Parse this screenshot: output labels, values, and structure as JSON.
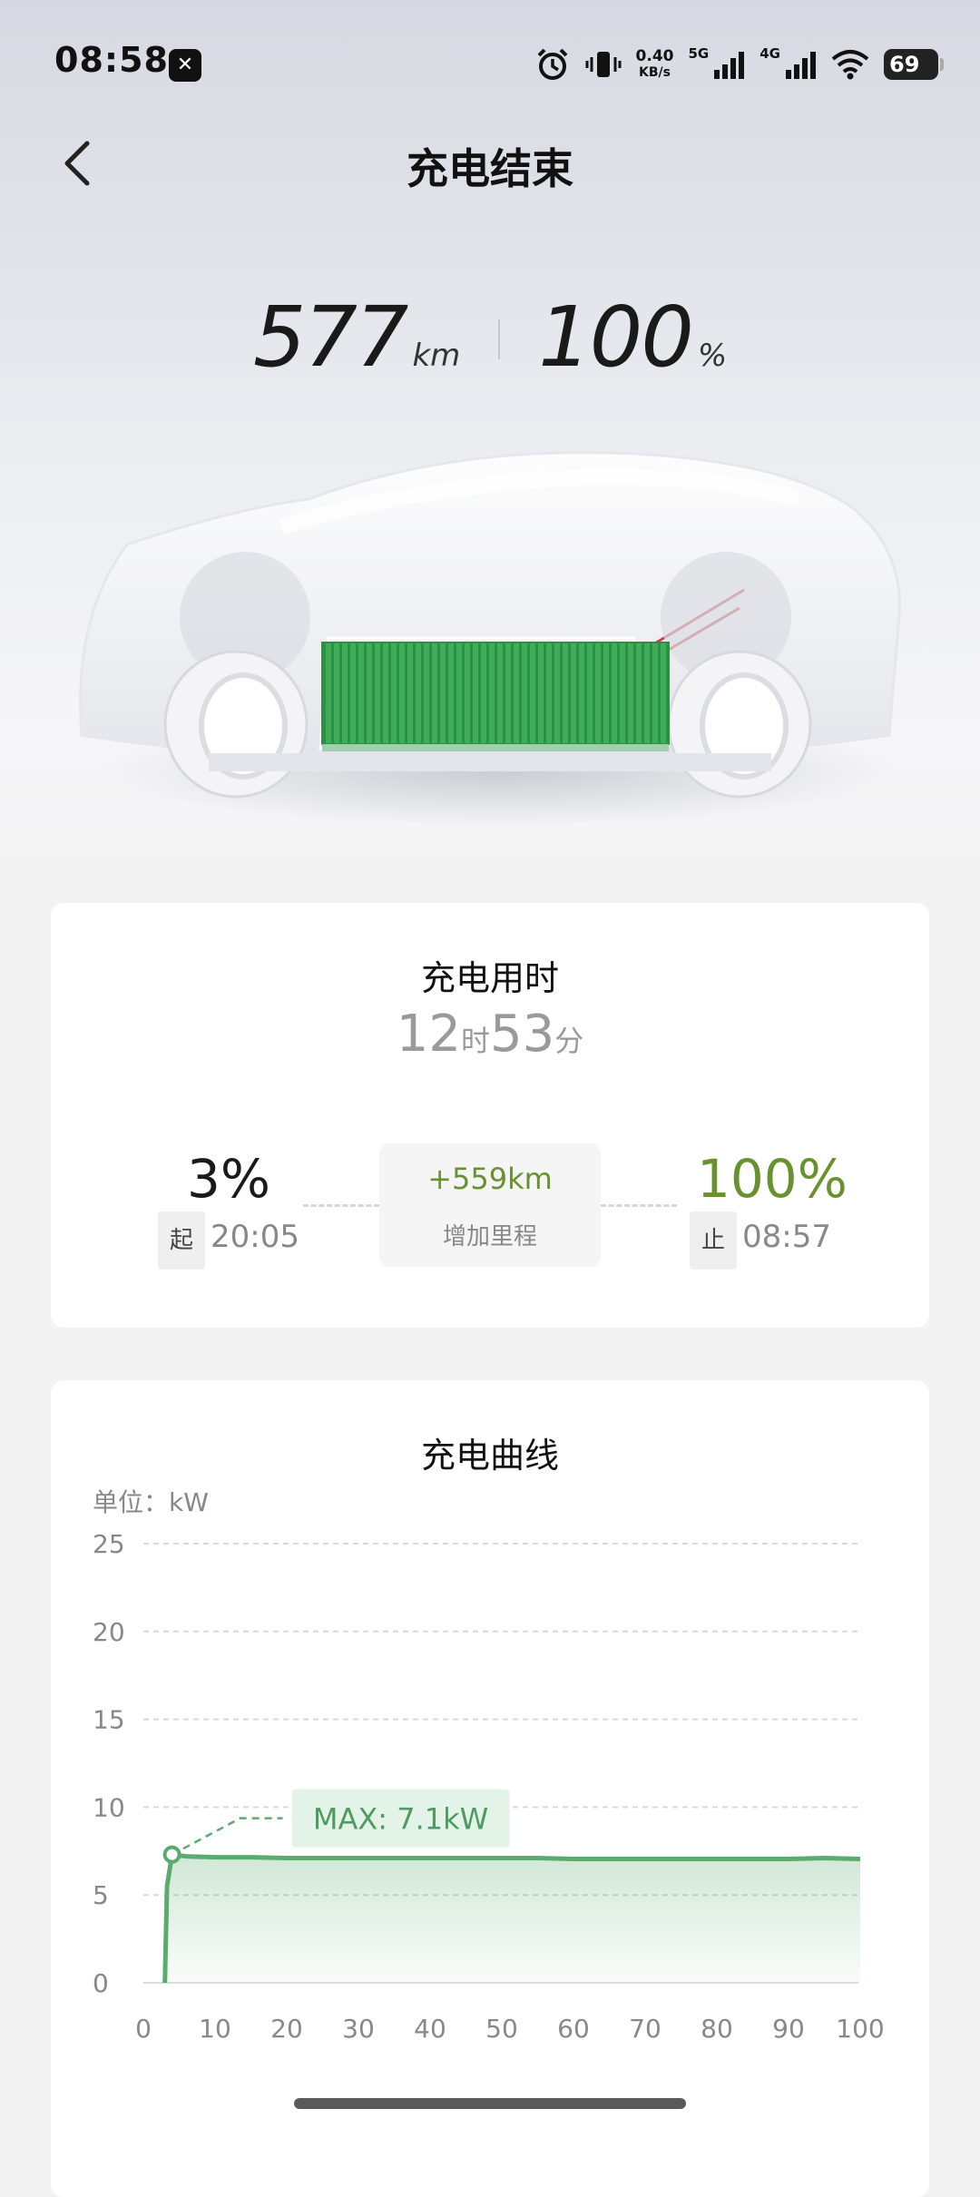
{
  "status_bar": {
    "time": "08:58",
    "net_speed_value": "0.40",
    "net_speed_unit": "KB/s",
    "sim1": "5G",
    "sim2": "4G",
    "battery": "69"
  },
  "nav": {
    "title": "充电结束"
  },
  "summary": {
    "range_value": "577",
    "range_unit": "km",
    "soc_value": "100",
    "soc_unit": "%"
  },
  "duration_card": {
    "title": "充电用时",
    "hours": "12",
    "hours_unit": "时",
    "minutes": "53",
    "minutes_unit": "分",
    "start_soc": "3%",
    "start_tag": "起",
    "start_time": "20:05",
    "added_range": "+559km",
    "added_label": "增加里程",
    "end_soc": "100%",
    "end_tag": "止",
    "end_time": "08:57"
  },
  "curve_card": {
    "title": "充电曲线"
  },
  "chart_data": {
    "type": "area",
    "title": "充电曲线",
    "unit_label": "单位：kW",
    "xlim": [
      0,
      100
    ],
    "ylim": [
      0,
      25
    ],
    "x_ticks": [
      0,
      10,
      20,
      30,
      40,
      50,
      60,
      70,
      80,
      90,
      100
    ],
    "y_ticks": [
      0,
      5,
      10,
      15,
      20,
      25
    ],
    "grid": true,
    "annotation": "MAX: 7.1kW",
    "max_point": [
      4,
      7.3
    ],
    "series": [
      {
        "color": "#5aab6e",
        "x": [
          3,
          3.3,
          4,
          6,
          10,
          15,
          20,
          25,
          30,
          35,
          40,
          45,
          50,
          55,
          60,
          65,
          70,
          75,
          80,
          85,
          90,
          95,
          100
        ],
        "y": [
          0,
          5.5,
          7.3,
          7.2,
          7.15,
          7.15,
          7.1,
          7.1,
          7.1,
          7.1,
          7.1,
          7.1,
          7.1,
          7.1,
          7.05,
          7.05,
          7.05,
          7.05,
          7.05,
          7.05,
          7.05,
          7.1,
          7.05
        ]
      }
    ]
  }
}
